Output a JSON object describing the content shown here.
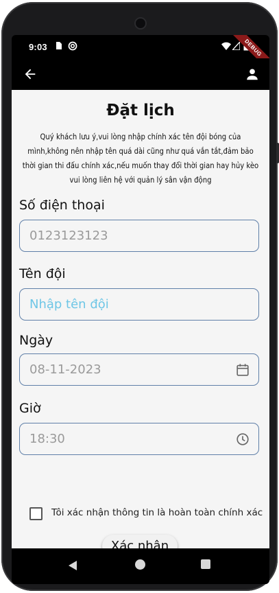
{
  "status_bar": {
    "time": "9:03",
    "icons": [
      "sim-card-icon",
      "sync-icon",
      "wifi-icon",
      "signal-icon",
      "battery-icon"
    ],
    "debug_banner": "DEBUG"
  },
  "app_bar": {
    "back_icon": "arrow-back-icon",
    "profile_icon": "person-icon"
  },
  "form": {
    "title": "Đặt lịch",
    "notice": "Quý khách lưu ý,vui lòng nhập chính xác tên đội bóng của mình,không nên nhập tên quá dài cũng như quá vắn tắt,đảm bảo thời gian thi đấu chính xác,nếu muốn thay đổi thời gian hay hủy kèo vui lòng liên hệ với quản lý sân vận động",
    "phone": {
      "label": "Số điện thoại",
      "value": "0123123123"
    },
    "team": {
      "label": "Tên đội",
      "placeholder": "Nhập tên đội"
    },
    "date": {
      "label": "Ngày",
      "value": "08-11-2023",
      "icon": "calendar-icon"
    },
    "time": {
      "label": "Giờ",
      "value": "18:30",
      "icon": "clock-icon"
    },
    "confirm_checkbox": {
      "label": "Tôi xác nhận thông tin là hoàn toàn chính xác",
      "checked": false
    },
    "submit_label": "Xác nhận"
  },
  "nav_bar": {
    "icons": [
      "nav-back-icon",
      "nav-home-icon",
      "nav-recents-icon"
    ]
  },
  "colors": {
    "field_border": "#5f7fa8",
    "placeholder_blue": "#6ec6e6",
    "background": "#f5f5f5",
    "debug_ribbon": "#8b1a1a"
  }
}
